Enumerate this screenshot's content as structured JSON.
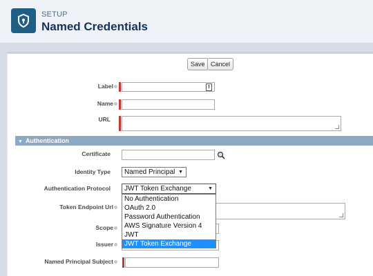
{
  "header": {
    "setup_label": "SETUP",
    "title": "Named Credentials"
  },
  "buttons": {
    "save": "Save",
    "cancel": "Cancel"
  },
  "fields": {
    "label": {
      "label": "Label",
      "value": ""
    },
    "name": {
      "label": "Name",
      "value": ""
    },
    "url": {
      "label": "URL",
      "value": ""
    }
  },
  "auth_section": {
    "title": "Authentication"
  },
  "auth": {
    "certificate": {
      "label": "Certificate",
      "value": ""
    },
    "identity_type": {
      "label": "Identity Type",
      "value": "Named Principal"
    },
    "protocol": {
      "label": "Authentication Protocol",
      "value": "JWT Token Exchange",
      "options": [
        "No Authentication",
        "OAuth 2.0",
        "Password Authentication",
        "AWS Signature Version 4",
        "JWT",
        "JWT Token Exchange"
      ]
    },
    "token_endpoint": {
      "label": "Token Endpoint Url"
    },
    "scope": {
      "label": "Scope"
    },
    "issuer": {
      "label": "Issuer"
    },
    "named_principal_subject": {
      "label": "Named Principal Subject"
    }
  },
  "colors": {
    "brand": "#1f5f86",
    "section_bar": "#8da9c4",
    "required": "#c23934",
    "selected_option": "#1e90ff"
  }
}
